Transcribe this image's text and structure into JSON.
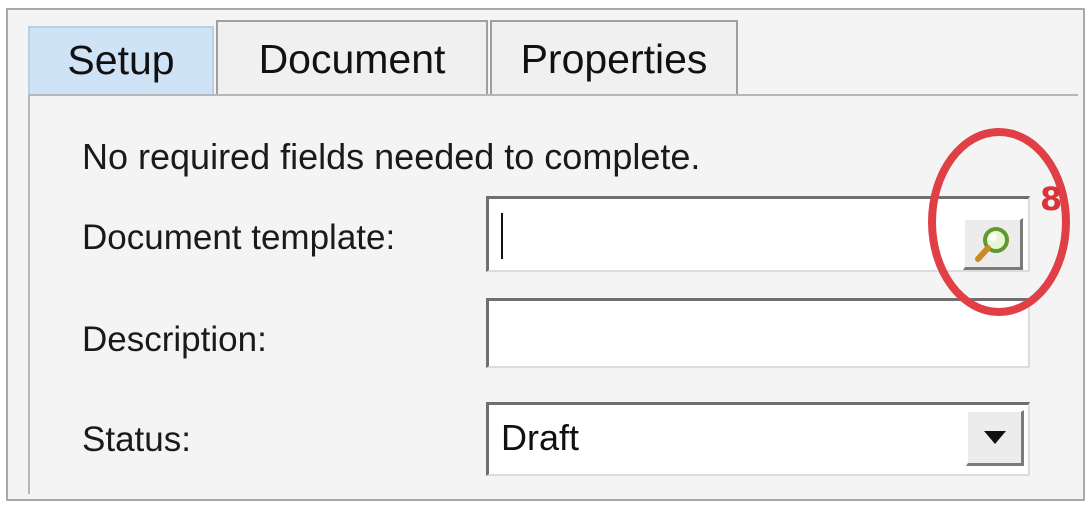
{
  "tabs": [
    {
      "label": "Setup",
      "active": true
    },
    {
      "label": "Document",
      "active": false
    },
    {
      "label": "Properties",
      "active": false
    }
  ],
  "form": {
    "message": "No required fields needed to complete.",
    "template_label": "Document template:",
    "template_value": "",
    "description_label": "Description:",
    "description_value": "",
    "status_label": "Status:",
    "status_value": "Draft"
  },
  "annotation": {
    "badge": "8",
    "color": "#df3f45"
  },
  "icons": {
    "lookup": "magnifier-icon",
    "dropdown": "triangle-down-icon"
  }
}
